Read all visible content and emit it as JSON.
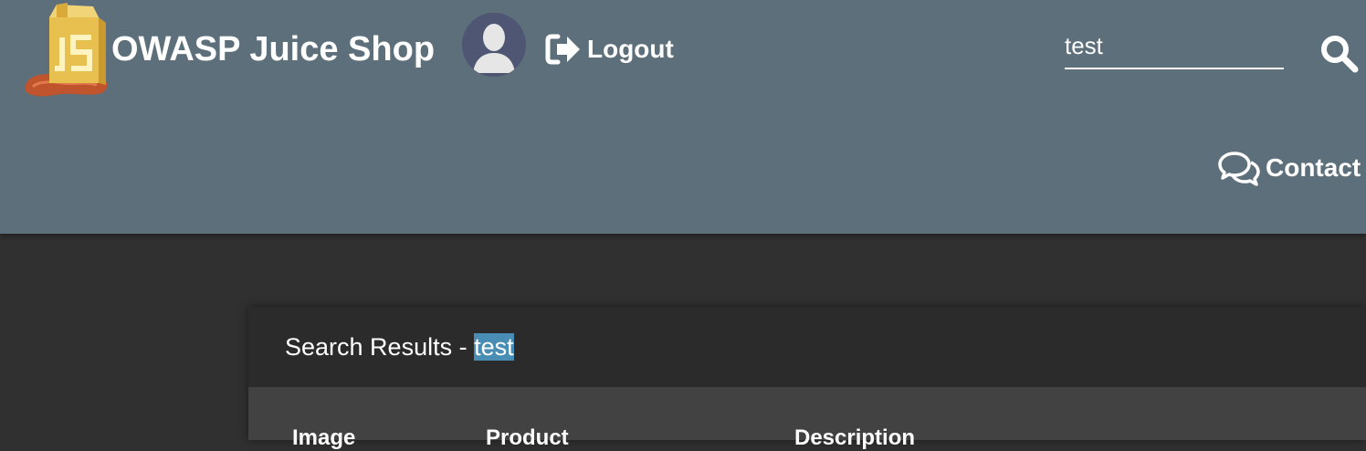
{
  "navbar": {
    "logo_icon": "juice-shop-carton-logo",
    "title": "OWASP Juice Shop",
    "avatar_icon": "user-silhouette-icon",
    "logout_icon": "sign-out-icon",
    "logout_label": "Logout",
    "search_value": "test",
    "search_icon": "magnifier-icon",
    "contact_icon": "comments-icon",
    "contact_label": "Contact",
    "background_color": "#5c6f7a"
  },
  "results": {
    "title_prefix": "Search Results - ",
    "query": "test",
    "columns": [
      "Image",
      "Product",
      "Description"
    ]
  },
  "colors": {
    "page_background": "#303030",
    "card_header": "#2b2b2b",
    "table_background": "#424242",
    "highlight": "#4a8db4"
  }
}
